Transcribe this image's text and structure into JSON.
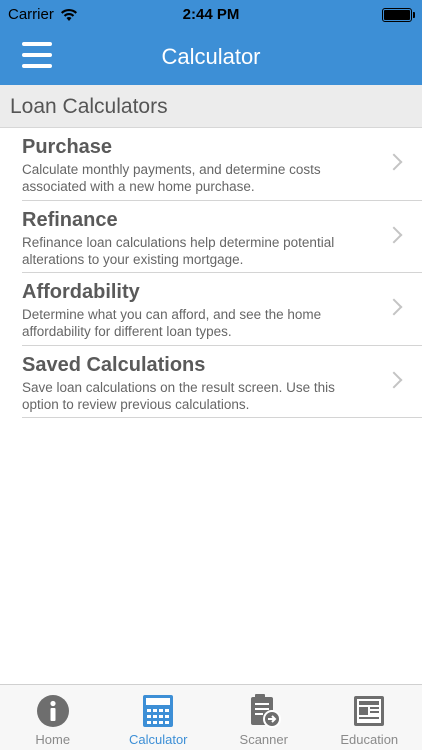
{
  "status": {
    "carrier": "Carrier",
    "time": "2:44 PM"
  },
  "header": {
    "title": "Calculator"
  },
  "section": {
    "title": "Loan Calculators"
  },
  "items": [
    {
      "title": "Purchase",
      "desc": "Calculate monthly payments, and determine costs associated with a new home purchase."
    },
    {
      "title": "Refinance",
      "desc": "Refinance loan calculations help determine potential alterations to your existing mortgage."
    },
    {
      "title": "Affordability",
      "desc": "Determine what you can afford, and see the home affordability for different loan types."
    },
    {
      "title": "Saved Calculations",
      "desc": "Save loan calculations on the result screen. Use this option to review previous calculations."
    }
  ],
  "tabs": [
    {
      "label": "Home",
      "icon": "info-icon"
    },
    {
      "label": "Calculator",
      "icon": "calculator-icon",
      "active": true
    },
    {
      "label": "Scanner",
      "icon": "scanner-icon"
    },
    {
      "label": "Education",
      "icon": "newspaper-icon"
    }
  ],
  "colors": {
    "accent": "#3d8fd6",
    "inactive_icon": "#6e6e6e"
  }
}
